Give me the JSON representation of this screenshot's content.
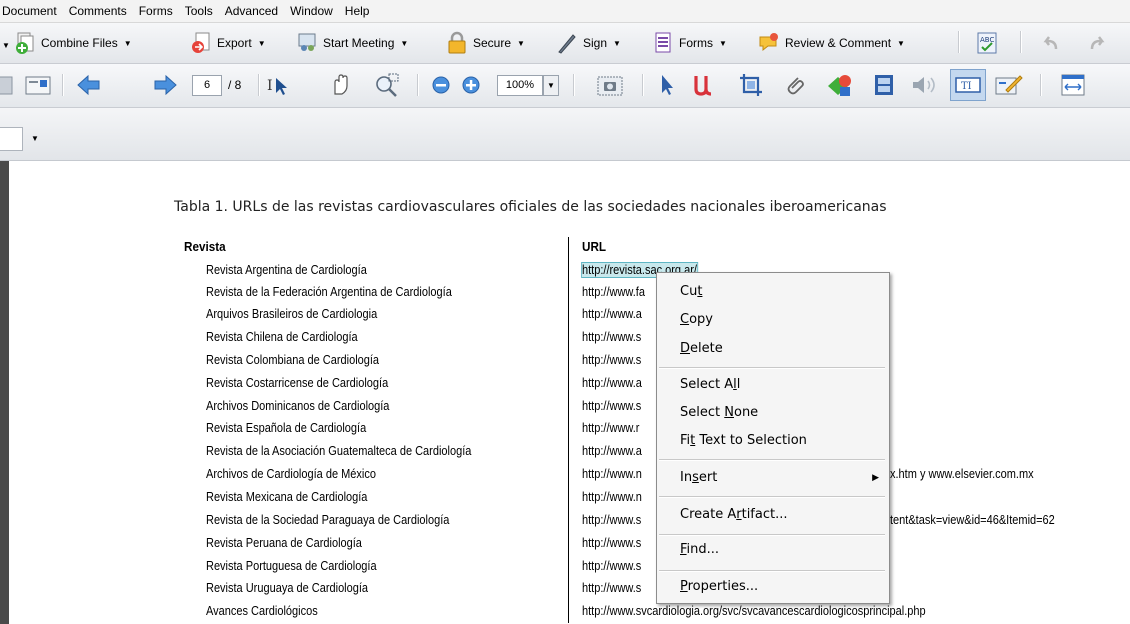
{
  "menubar": {
    "items": [
      "Document",
      "Comments",
      "Forms",
      "Tools",
      "Advanced",
      "Window",
      "Help"
    ]
  },
  "tasks_toolbar": {
    "combine": "Combine Files",
    "export": "Export",
    "start_meeting": "Start Meeting",
    "secure": "Secure",
    "sign": "Sign",
    "forms": "Forms",
    "review": "Review & Comment",
    "dropdown_glyph": "▼"
  },
  "nav_toolbar": {
    "current_page": "6",
    "total_pages": "/ 8",
    "zoom": "100%"
  },
  "document": {
    "caption": "Tabla 1. URLs de las revistas cardiovasculares oficiales de las sociedades nacionales iberoamericanas",
    "col_revista": "Revista",
    "col_url": "URL",
    "rows": [
      {
        "revista": "Revista Argentina de Cardiología",
        "url": "http://revista.sac.org.ar/"
      },
      {
        "revista": "Revista de la Federación Argentina de Cardiología",
        "url": "http://www.fa"
      },
      {
        "revista": "Arquivos Brasileiros de Cardiologia",
        "url": "http://www.a"
      },
      {
        "revista": "Revista Chilena de Cardiología",
        "url": "http://www.s"
      },
      {
        "revista": "Revista Colombiana de Cardiología",
        "url": "http://www.s"
      },
      {
        "revista": "Revista Costarricense de Cardiología",
        "url": "http://www.a"
      },
      {
        "revista": "Archivos Dominicanos de Cardiología",
        "url": "http://www.s"
      },
      {
        "revista": "Revista Española de Cardiología",
        "url": "http://www.r"
      },
      {
        "revista": "Revista de la Asociación Guatemalteca de Cardiología",
        "url": "http://www.a"
      },
      {
        "revista": "Archivos de Cardiología de México",
        "url": "http://www.n",
        "url_tail": "x.htm y www.elsevier.com.mx"
      },
      {
        "revista": "Revista Mexicana de Cardiología",
        "url": "http://www.n"
      },
      {
        "revista": "Revista de la Sociedad Paraguaya de Cardiología",
        "url": "http://www.s",
        "url_tail": "tent&task=view&id=46&Itemid=62"
      },
      {
        "revista": "Revista Peruana de Cardiología",
        "url": "http://www.s"
      },
      {
        "revista": "Revista Portuguesa de Cardiología",
        "url": "http://www.s"
      },
      {
        "revista": "Revista Uruguaya de Cardiología",
        "url": "http://www.s"
      },
      {
        "revista": "Avances Cardiológicos",
        "url": "http://www.svcardiologia.org/svc/svcavancescardiologicosprincipal.php"
      }
    ]
  },
  "context_menu": {
    "items": [
      {
        "pre": "Cu",
        "key": "t",
        "post": ""
      },
      {
        "pre": "",
        "key": "C",
        "post": "opy"
      },
      {
        "pre": "",
        "key": "D",
        "post": "elete"
      },
      {
        "pre": "Select A",
        "key": "l",
        "post": "l"
      },
      {
        "pre": "Select ",
        "key": "N",
        "post": "one"
      },
      {
        "pre": "Fi",
        "key": "t",
        "post": " Text to Selection"
      },
      {
        "pre": "In",
        "key": "s",
        "post": "ert"
      },
      {
        "pre": "Create A",
        "key": "r",
        "post": "tifact..."
      },
      {
        "pre": "",
        "key": "F",
        "post": "ind..."
      },
      {
        "pre": "",
        "key": "P",
        "post": "roperties..."
      }
    ],
    "submenu_arrow": "▶"
  },
  "colors": {
    "selection": "#c8e8ec",
    "accent_blue": "#2f6fc9"
  }
}
